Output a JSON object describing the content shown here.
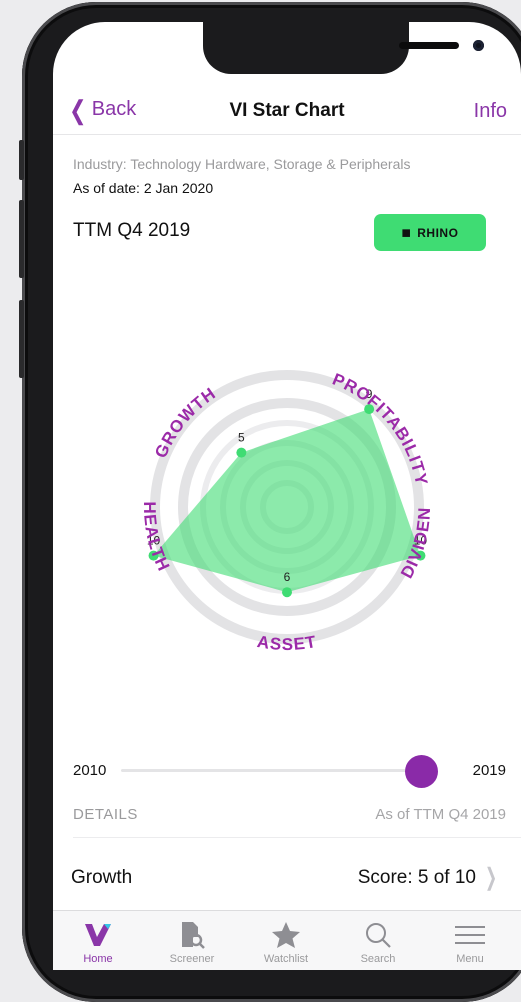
{
  "nav": {
    "back_label": "Back",
    "title": "VI Star Chart",
    "info_label": "Info"
  },
  "header": {
    "industry": "Industry: Technology Hardware, Storage & Peripherals",
    "as_of": "As of date: 2 Jan 2020",
    "period": "TTM Q4 2019",
    "badge_label": "RHINO",
    "badge_icon": "rhino-icon"
  },
  "chart_data": {
    "type": "radar",
    "axes": [
      "PROFITABILITY",
      "HEALTH",
      "ASSET",
      "DIVIDEND",
      "GROWTH"
    ],
    "values": [
      9,
      10,
      6,
      10,
      5
    ],
    "range": [
      0,
      10
    ],
    "fill_color": "#3fdc73",
    "label_color": "#9b2aa8"
  },
  "slider": {
    "start_year": "2010",
    "end_year": "2019",
    "value_fraction": 1.0
  },
  "details": {
    "label": "DETAILS",
    "as_of": "As of TTM Q4 2019",
    "rows": [
      {
        "label": "Growth",
        "score": "Score: 5 of 10"
      }
    ]
  },
  "tabbar": {
    "tabs": [
      {
        "label": "Home",
        "icon": "home-logo-icon",
        "active": true
      },
      {
        "label": "Screener",
        "icon": "screener-icon",
        "active": false
      },
      {
        "label": "Watchlist",
        "icon": "star-icon",
        "active": false
      },
      {
        "label": "Search",
        "icon": "search-icon",
        "active": false
      },
      {
        "label": "Menu",
        "icon": "menu-icon",
        "active": false
      }
    ]
  },
  "colors": {
    "accent": "#8a36a8",
    "badge": "#3fdc73"
  }
}
